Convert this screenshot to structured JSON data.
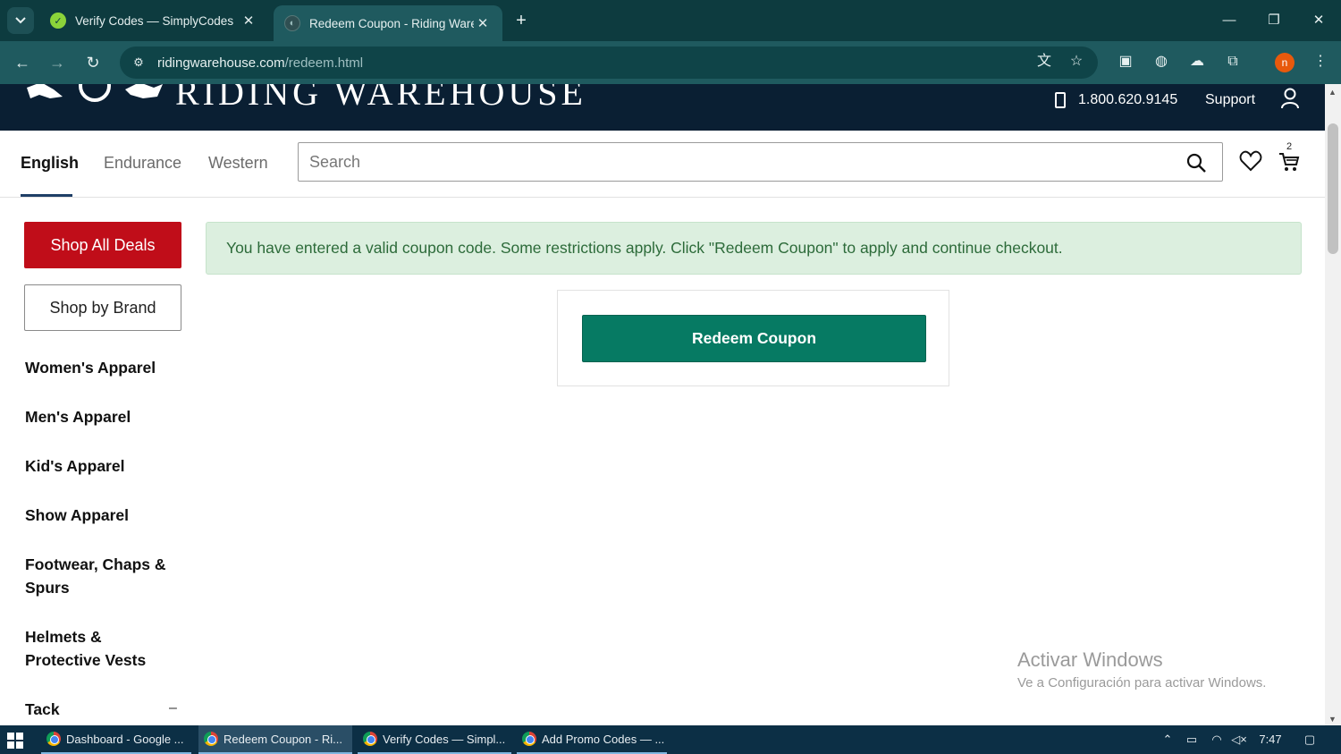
{
  "browser": {
    "tabs": [
      {
        "title": "Verify Codes — SimplyCodes",
        "active": false
      },
      {
        "title": "Redeem Coupon - Riding Warehouse",
        "active": true
      }
    ],
    "url_host": "ridingwarehouse.com",
    "url_path": "/redeem.html",
    "profile_initial": "n"
  },
  "header": {
    "logo_text": "RIDING WAREHOUSE",
    "phone": "1.800.620.9145",
    "support_label": "Support"
  },
  "catnav": {
    "items": [
      "English",
      "Endurance",
      "Western"
    ],
    "active_index": 0,
    "search_placeholder": "Search",
    "cart_count": "2"
  },
  "sidebar": {
    "deals_label": "Shop All Deals",
    "brand_label": "Shop by Brand",
    "links": [
      "Women's Apparel",
      "Men's Apparel",
      "Kid's Apparel",
      "Show Apparel",
      "Footwear, Chaps & Spurs",
      "Helmets & Protective Vests",
      "Tack"
    ],
    "tack_toggle": "–"
  },
  "main": {
    "alert_text": "You have entered a valid coupon code. Some restrictions apply. Click \"Redeem Coupon\" to apply and continue checkout.",
    "redeem_label": "Redeem Coupon"
  },
  "watermark": {
    "line1": "Activar Windows",
    "line2": "Ve a Configuración para activar Windows."
  },
  "taskbar": {
    "items": [
      "Dashboard - Google ...",
      "Redeem Coupon - Ri...",
      "Verify Codes — Simpl...",
      "Add Promo Codes — ..."
    ],
    "time": "7:47"
  },
  "colors": {
    "chrome_dark": "#0d3b3f",
    "chrome_mid": "#1f5a5f",
    "site_navy": "#0a1f33",
    "deals_red": "#c00d19",
    "redeem_green": "#067a63",
    "alert_bg": "#dcefdf",
    "alert_text": "#2d6b3a"
  }
}
